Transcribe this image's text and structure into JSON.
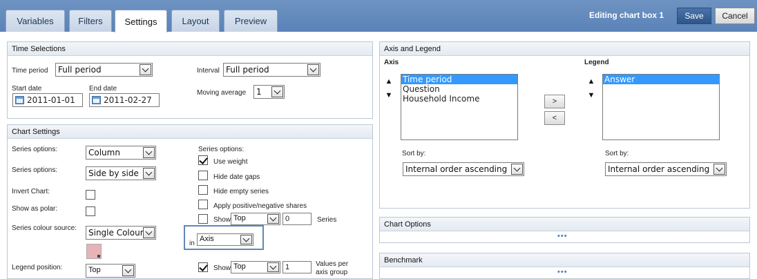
{
  "tabs": [
    "Variables",
    "Filters",
    "Settings",
    "Layout",
    "Preview"
  ],
  "header": {
    "editing_label": "Editing chart box 1",
    "save": "Save",
    "cancel": "Cancel"
  },
  "time_selections": {
    "title": "Time Selections",
    "time_period_label": "Time period",
    "time_period_value": "Full period",
    "interval_label": "Interval",
    "interval_value": "Full period",
    "start_date_label": "Start date",
    "start_date": "2011-01-01",
    "end_date_label": "End date",
    "end_date": "2011-02-27",
    "moving_average_label": "Moving average",
    "moving_average_value": "1"
  },
  "chart_settings": {
    "title": "Chart Settings",
    "series_options_label_1": "Series options:",
    "series_options_value_1": "Column",
    "series_options_label_2": "Series options:",
    "series_options_value_2": "Side by side",
    "invert_chart_label": "Invert Chart:",
    "show_as_polar_label": "Show as polar:",
    "series_colour_source_label": "Series colour source:",
    "series_colour_source_value": "Single Colour",
    "legend_position_label": "Legend position:",
    "legend_position_value": "Top",
    "right_series_options_label": "Series options:",
    "use_weight": "Use weight",
    "hide_date_gaps": "Hide date gaps",
    "hide_empty_series": "Hide empty series",
    "apply_shares": "Apply positive/negative shares",
    "show_label": "Show",
    "show_top_value": "Top",
    "show_count": "0",
    "series_label": "Series",
    "in_label": "in",
    "in_value": "Axis",
    "show2_label": "Show",
    "show2_top_value": "Top",
    "show2_count": "1",
    "values_per_label": "Values per axis group"
  },
  "axis_legend": {
    "title": "Axis and Legend",
    "axis_label": "Axis",
    "axis_items": [
      "Time period",
      "Question",
      "Household Income"
    ],
    "legend_label": "Legend",
    "legend_items": [
      "Answer"
    ],
    "move_right": ">",
    "move_left": "<",
    "sort_by_label": "Sort by:",
    "axis_sort_value": "Internal order ascending",
    "legend_sort_label": "Sort by:",
    "legend_sort_value": "Internal order ascending"
  },
  "chart_options": {
    "title": "Chart Options",
    "more": "•••"
  },
  "benchmark": {
    "title": "Benchmark",
    "more": "•••"
  }
}
